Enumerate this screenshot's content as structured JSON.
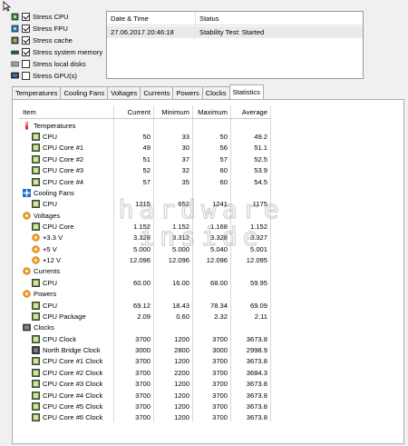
{
  "stress_options": [
    {
      "label": "Stress CPU",
      "checked": true,
      "icon": "cpu-chip-icon"
    },
    {
      "label": "Stress FPU",
      "checked": true,
      "icon": "fpu-chip-icon"
    },
    {
      "label": "Stress cache",
      "checked": true,
      "icon": "cache-chip-icon"
    },
    {
      "label": "Stress system memory",
      "checked": true,
      "icon": "memory-module-icon"
    },
    {
      "label": "Stress local disks",
      "checked": false,
      "icon": "disk-drive-icon"
    },
    {
      "label": "Stress GPU(s)",
      "checked": false,
      "icon": "gpu-icon"
    }
  ],
  "status_table": {
    "col_date": "Date & Time",
    "col_status": "Status",
    "row_date": "27.06.2017 20:46:18",
    "row_status": "Stability Test: Started"
  },
  "tabs": [
    "Temperatures",
    "Cooling Fans",
    "Voltages",
    "Currents",
    "Powers",
    "Clocks",
    "Statistics"
  ],
  "active_tab": "Statistics",
  "grid_headers": {
    "item": "Item",
    "current": "Current",
    "minimum": "Minimum",
    "maximum": "Maximum",
    "average": "Average"
  },
  "rows": [
    {
      "kind": "group",
      "label": "Temperatures",
      "icon": "thermometer-icon"
    },
    {
      "kind": "item",
      "label": "CPU",
      "current": "50",
      "minimum": "33",
      "maximum": "50",
      "average": "49.2"
    },
    {
      "kind": "item",
      "label": "CPU Core #1",
      "current": "49",
      "minimum": "30",
      "maximum": "56",
      "average": "51.1"
    },
    {
      "kind": "item",
      "label": "CPU Core #2",
      "current": "51",
      "minimum": "37",
      "maximum": "57",
      "average": "52.5"
    },
    {
      "kind": "item",
      "label": "CPU Core #3",
      "current": "52",
      "minimum": "32",
      "maximum": "60",
      "average": "53.9"
    },
    {
      "kind": "item",
      "label": "CPU Core #4",
      "current": "57",
      "minimum": "35",
      "maximum": "60",
      "average": "54.5"
    },
    {
      "kind": "group",
      "label": "Cooling Fans",
      "icon": "fan-icon"
    },
    {
      "kind": "item",
      "label": "CPU",
      "current": "1215",
      "minimum": "652",
      "maximum": "1241",
      "average": "1175"
    },
    {
      "kind": "group",
      "label": "Voltages",
      "icon": "voltage-icon"
    },
    {
      "kind": "item",
      "label": "CPU Core",
      "current": "1.152",
      "minimum": "1.152",
      "maximum": "1.168",
      "average": "1.152"
    },
    {
      "kind": "volt",
      "label": "+3.3 V",
      "current": "3.328",
      "minimum": "3.312",
      "maximum": "3.328",
      "average": "3.327"
    },
    {
      "kind": "volt",
      "label": "+5 V",
      "current": "5.000",
      "minimum": "5.000",
      "maximum": "5.040",
      "average": "5.001"
    },
    {
      "kind": "volt",
      "label": "+12 V",
      "current": "12.096",
      "minimum": "12.096",
      "maximum": "12.096",
      "average": "12.095"
    },
    {
      "kind": "group",
      "label": "Currents",
      "icon": "current-icon"
    },
    {
      "kind": "item",
      "label": "CPU",
      "current": "60.00",
      "minimum": "16.00",
      "maximum": "68.00",
      "average": "59.95"
    },
    {
      "kind": "group",
      "label": "Powers",
      "icon": "power-icon"
    },
    {
      "kind": "item",
      "label": "CPU",
      "current": "69.12",
      "minimum": "18.43",
      "maximum": "78.34",
      "average": "69.09"
    },
    {
      "kind": "item",
      "label": "CPU Package",
      "current": "2.09",
      "minimum": "0.60",
      "maximum": "2.32",
      "average": "2.11"
    },
    {
      "kind": "group",
      "label": "Clocks",
      "icon": "clock-icon"
    },
    {
      "kind": "item",
      "label": "CPU Clock",
      "current": "3700",
      "minimum": "1200",
      "maximum": "3700",
      "average": "3673.8"
    },
    {
      "kind": "nb",
      "label": "North Bridge Clock",
      "current": "3000",
      "minimum": "2800",
      "maximum": "3000",
      "average": "2998.9"
    },
    {
      "kind": "item",
      "label": "CPU Core #1 Clock",
      "current": "3700",
      "minimum": "1200",
      "maximum": "3700",
      "average": "3673.8"
    },
    {
      "kind": "item",
      "label": "CPU Core #2 Clock",
      "current": "3700",
      "minimum": "2200",
      "maximum": "3700",
      "average": "3684.3"
    },
    {
      "kind": "item",
      "label": "CPU Core #3 Clock",
      "current": "3700",
      "minimum": "1200",
      "maximum": "3700",
      "average": "3673.8"
    },
    {
      "kind": "item",
      "label": "CPU Core #4 Clock",
      "current": "3700",
      "minimum": "1200",
      "maximum": "3700",
      "average": "3673.8"
    },
    {
      "kind": "item",
      "label": "CPU Core #5 Clock",
      "current": "3700",
      "minimum": "1200",
      "maximum": "3700",
      "average": "3673.8"
    },
    {
      "kind": "item",
      "label": "CPU Core #6 Clock",
      "current": "3700",
      "minimum": "1200",
      "maximum": "3700",
      "average": "3673.8"
    }
  ],
  "watermark": {
    "line1": "hardware",
    "line2": "inside"
  },
  "colors": {
    "sensor_green": "#6a8a35",
    "group_orange": "#d2691e",
    "fan_blue": "#1e6fc9"
  }
}
